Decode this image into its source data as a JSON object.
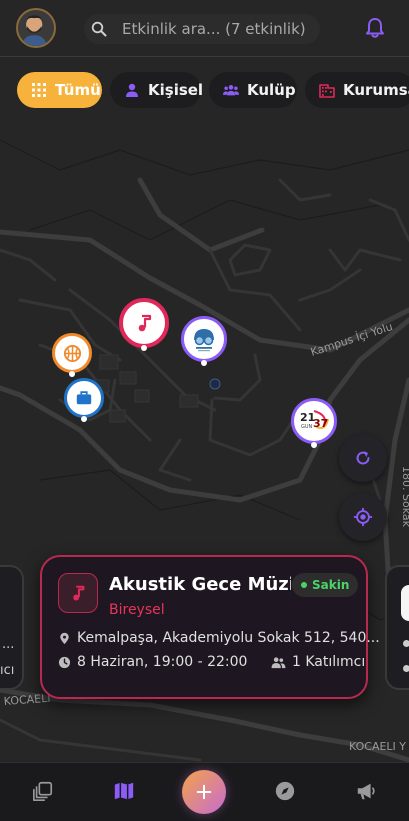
{
  "search": {
    "placeholder": "Etkinlik ara... (7 etkinlik)"
  },
  "filters": [
    {
      "label": "Tümü",
      "icon": "grid-icon",
      "active": true
    },
    {
      "label": "Kişisel",
      "icon": "person-icon",
      "active": false
    },
    {
      "label": "Kulüp",
      "icon": "group-icon",
      "active": false
    },
    {
      "label": "Kurumsal",
      "icon": "building-icon",
      "active": false
    }
  ],
  "map": {
    "labels": {
      "kampus": "Kampus İçi Yolu",
      "kocaeli_1": "KOCAELI",
      "kocaeli_2": "KOCAELI Y",
      "sokak": "180. Sokak"
    },
    "markers": {
      "logo_text": "21 GUN 37"
    }
  },
  "event_card": {
    "title": "Akustik Gece Müzi...",
    "category": "Bireysel",
    "status": "Sakin",
    "address": "Kemalpaşa, Akademiyolu Sokak 512, 540...",
    "datetime": "8 Haziran, 19:00 - 22:00",
    "participants": "1 Katılımcı"
  },
  "side_card_left": {
    "line_1": "...",
    "line_2": "ıcı"
  },
  "colors": {
    "accent": "#f6b23b",
    "music": "#e0295a",
    "status_green": "#4bd36a",
    "purple": "#8b5cf6"
  }
}
